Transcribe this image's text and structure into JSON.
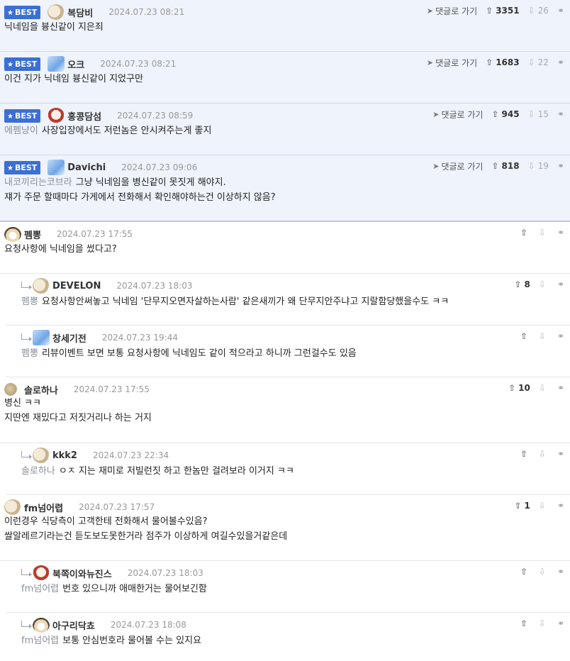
{
  "labels": {
    "best": "BEST",
    "goto": "댓글로 가기"
  },
  "colors": {
    "accent": "#3b6fd6",
    "best_bg": "#eef3fc"
  },
  "comments": [
    {
      "best": true,
      "nick": "복담비",
      "avatar": "dog",
      "time": "2024.07.23 08:21",
      "likes": "3351",
      "dislikes": "26",
      "lines": [
        "닉네임을 븅신같이 지은죄"
      ]
    },
    {
      "best": true,
      "nick": "오크",
      "avatar": "blue",
      "time": "2024.07.23 08:21",
      "likes": "1683",
      "dislikes": "22",
      "lines": [
        "이건 지가 닉네임 븅신같이 지었구만"
      ]
    },
    {
      "best": true,
      "nick": "홍콩담섬",
      "avatar": "red",
      "time": "2024.07.23 08:59",
      "likes": "945",
      "dislikes": "15",
      "mention": "에펨냥이",
      "lines": [
        "사장입장에서도 저런놈은 안시켜주는게 좋지"
      ]
    },
    {
      "best": true,
      "nick": "Davichi",
      "avatar": "blue",
      "time": "2024.07.23 09:06",
      "likes": "818",
      "dislikes": "19",
      "mention": "내코끼리는코브라",
      "lines": [
        "그냥 닉네임을 병신같이 못짓게 해야지.",
        "쟤가 주문 할때마다 가게에서 전화해서 확인해야하는건 이상하지 않음?"
      ]
    },
    {
      "nick": "펨뽕",
      "avatar": "fox",
      "time": "2024.07.23 17:55",
      "lines": [
        "요청사항에 닉네임을 썼다고?"
      ]
    },
    {
      "reply": true,
      "nick": "DEVELON",
      "avatar": "dog",
      "time": "2024.07.23 18:03",
      "likes": "8",
      "mention": "펨뽕",
      "lines": [
        "요청사항안써놓고 닉네임 '단무지오면자살하는사람' 같은새끼가 왜 단무지안주냐고 지랄함당했을수도 ㅋㅋ"
      ]
    },
    {
      "reply": true,
      "nick": "창세기전",
      "avatar": "blue",
      "time": "2024.07.23 19:44",
      "mention": "펨뽕",
      "lines": [
        "리뷰이벤트 보면 보통 요청사항에 닉네임도 같이 적으라고 하니까 그런걸수도 있음"
      ]
    },
    {
      "nick": "솔로하나",
      "avatar": "ball",
      "time": "2024.07.23 17:55",
      "likes": "10",
      "lines": [
        "병신 ㅋㅋ",
        "지딴엔 재밌다고 저짓거리나 하는 거지"
      ]
    },
    {
      "reply": true,
      "nick": "kkk2",
      "avatar": "dog",
      "time": "2024.07.23 22:34",
      "mention": "솔로하나",
      "lines": [
        "ㅇㅈ 지는 재미로 저빌런짓 하고 한놈만 걸려보라 이거지 ㅋㅋ"
      ]
    },
    {
      "nick": "fm넘어렵",
      "avatar": "dog",
      "time": "2024.07.23 17:57",
      "likes": "1",
      "lines": [
        "이런경우 식당측이 고객한테 전화해서 물어볼수있음?",
        "쌀알레르기라는건 듣도보도못한거라 점주가 이상하게 여길수있을거같은데"
      ]
    },
    {
      "reply": true,
      "nick": "북쪽이와뉴진스",
      "avatar": "red",
      "time": "2024.07.23 18:03",
      "mention": "fm넘어렵",
      "lines": [
        "번호 있으니까 애매한거는 물어보긴함"
      ]
    },
    {
      "reply": true,
      "nick": "아구리닥쵸",
      "avatar": "fox",
      "time": "2024.07.23 18:08",
      "mention": "fm넘어렵",
      "lines": [
        "보통 안심번호라 물어볼 수는 있지요"
      ]
    }
  ]
}
